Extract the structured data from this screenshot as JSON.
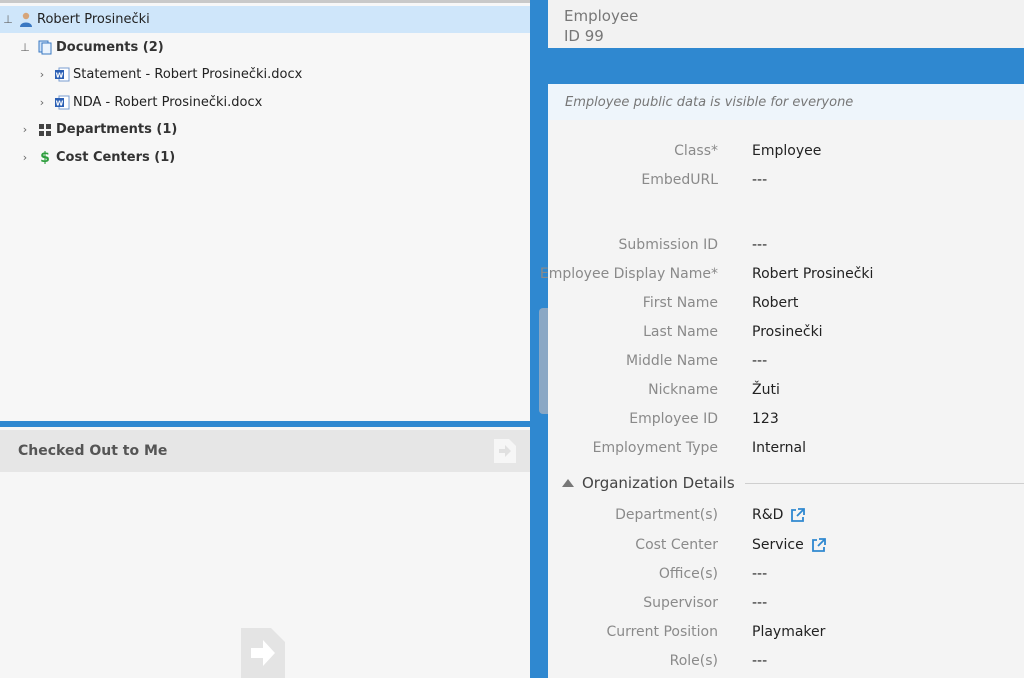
{
  "tree": {
    "root": "Robert Prosinečki",
    "documents": "Documents (2)",
    "doc1": "Statement - Robert Prosinečki.docx",
    "doc2": "NDA - Robert Prosinečki.docx",
    "departments": "Departments (1)",
    "cost_centers": "Cost Centers (1)"
  },
  "checked_out": {
    "title": "Checked Out to Me"
  },
  "object": {
    "type": "Employee",
    "id": "ID 99",
    "notice": "Employee public data is visible for everyone"
  },
  "props": [
    {
      "label": "Class*",
      "value": "Employee"
    },
    {
      "label": "EmbedURL",
      "value": "---"
    },
    {
      "label": "Submission ID",
      "value": "---"
    },
    {
      "label": "Employee Display Name*",
      "value": "Robert Prosinečki"
    },
    {
      "label": "First Name",
      "value": "Robert"
    },
    {
      "label": "Last Name",
      "value": "Prosinečki"
    },
    {
      "label": "Middle Name",
      "value": "---"
    },
    {
      "label": "Nickname",
      "value": "Žuti"
    },
    {
      "label": "Employee ID",
      "value": "123"
    },
    {
      "label": "Employment Type",
      "value": "Internal"
    }
  ],
  "org_section": "Organization Details",
  "org_props": [
    {
      "label": "Department(s)",
      "value": "R&D"
    },
    {
      "label": "Cost Center",
      "value": "Service"
    },
    {
      "label": "Office(s)",
      "value": "---"
    },
    {
      "label": "Supervisor",
      "value": "---"
    },
    {
      "label": "Current Position",
      "value": "Playmaker"
    },
    {
      "label": "Role(s)",
      "value": "---"
    }
  ],
  "colors": {
    "accent": "#2f88d0",
    "selection": "#cfe6fa",
    "money": "#2e9e3e",
    "word": "#2b5fb4"
  },
  "icons": {
    "root": "person-icon",
    "documents": "documents-icon",
    "doc": "word-document-icon",
    "departments": "grid-icon",
    "cost_centers": "dollar-icon",
    "external": "external-link-icon",
    "checkout": "document-arrow-icon"
  }
}
